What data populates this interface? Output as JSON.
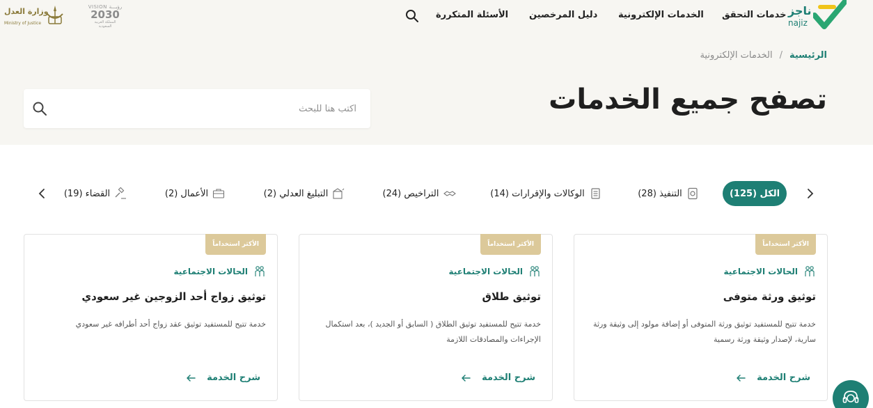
{
  "header": {
    "logo_ar": "ناجز",
    "logo_en": "najiz",
    "nav": [
      {
        "label": "خدمات التحقق"
      },
      {
        "label": "الخدمات الإلكترونية"
      },
      {
        "label": "دليل المرخصين"
      },
      {
        "label": "الأسئلة المتكررة"
      }
    ],
    "vision_top": "VISION رؤيـــة",
    "vision_year": "2030",
    "vision_sub": "المملكة العربية السعودية",
    "moj_ar": "وزارة العدل",
    "moj_en": "Ministry of Justice"
  },
  "breadcrumb": {
    "home": "الرئيسية",
    "separator": "/",
    "current": "الخدمات الإلكترونية"
  },
  "page_title": "تصفح جميع الخدمات",
  "search": {
    "placeholder": "اكتب هنا للبحث"
  },
  "tabs": [
    {
      "label": "الكل (125)",
      "icon": "none",
      "active": true
    },
    {
      "label": "التنفيذ (28)",
      "icon": "document-icon"
    },
    {
      "label": "الوكالات والإقرارات (14)",
      "icon": "papers-icon"
    },
    {
      "label": "التراخيص (24)",
      "icon": "handshake-icon"
    },
    {
      "label": "التبليغ العدلي (2)",
      "icon": "notify-icon"
    },
    {
      "label": "الأعمال (2)",
      "icon": "briefcase-icon"
    },
    {
      "label": "القضاء (19)",
      "icon": "gavel-icon"
    }
  ],
  "cards": [
    {
      "badge": "الأكثر استخداماً",
      "category": "الحالات الاجتماعية",
      "title": "توثيق ورثة متوفى",
      "description": "خدمة تتيح للمستفيد توثيق ورثة المتوفى أو إضافة مولود إلى وثيقة ورثة سارية، لإصدار وثيقة ورثة رسمية",
      "link": "شرح الخدمة"
    },
    {
      "badge": "الأكثر استخداماً",
      "category": "الحالات الاجتماعية",
      "title": "توثيق طلاق",
      "description": "خدمة تتيح للمستفيد توثيق الطلاق ( السابق أو الجديد )، بعد استكمال الإجراءات والمصادقات اللازمة",
      "link": "شرح الخدمة"
    },
    {
      "badge": "الأكثر استخداماً",
      "category": "الحالات الاجتماعية",
      "title": "توثيق زواج أحد الزوجين غير سعودي",
      "description": "خدمة تتيح للمستفيد توثيق عقد زواج أحد أطرافه غير سعودي",
      "link": "شرح الخدمة"
    }
  ],
  "colors": {
    "brand": "#1e7f74",
    "badge": "#dcc99a",
    "hero_bg": "#f7f6f2"
  }
}
